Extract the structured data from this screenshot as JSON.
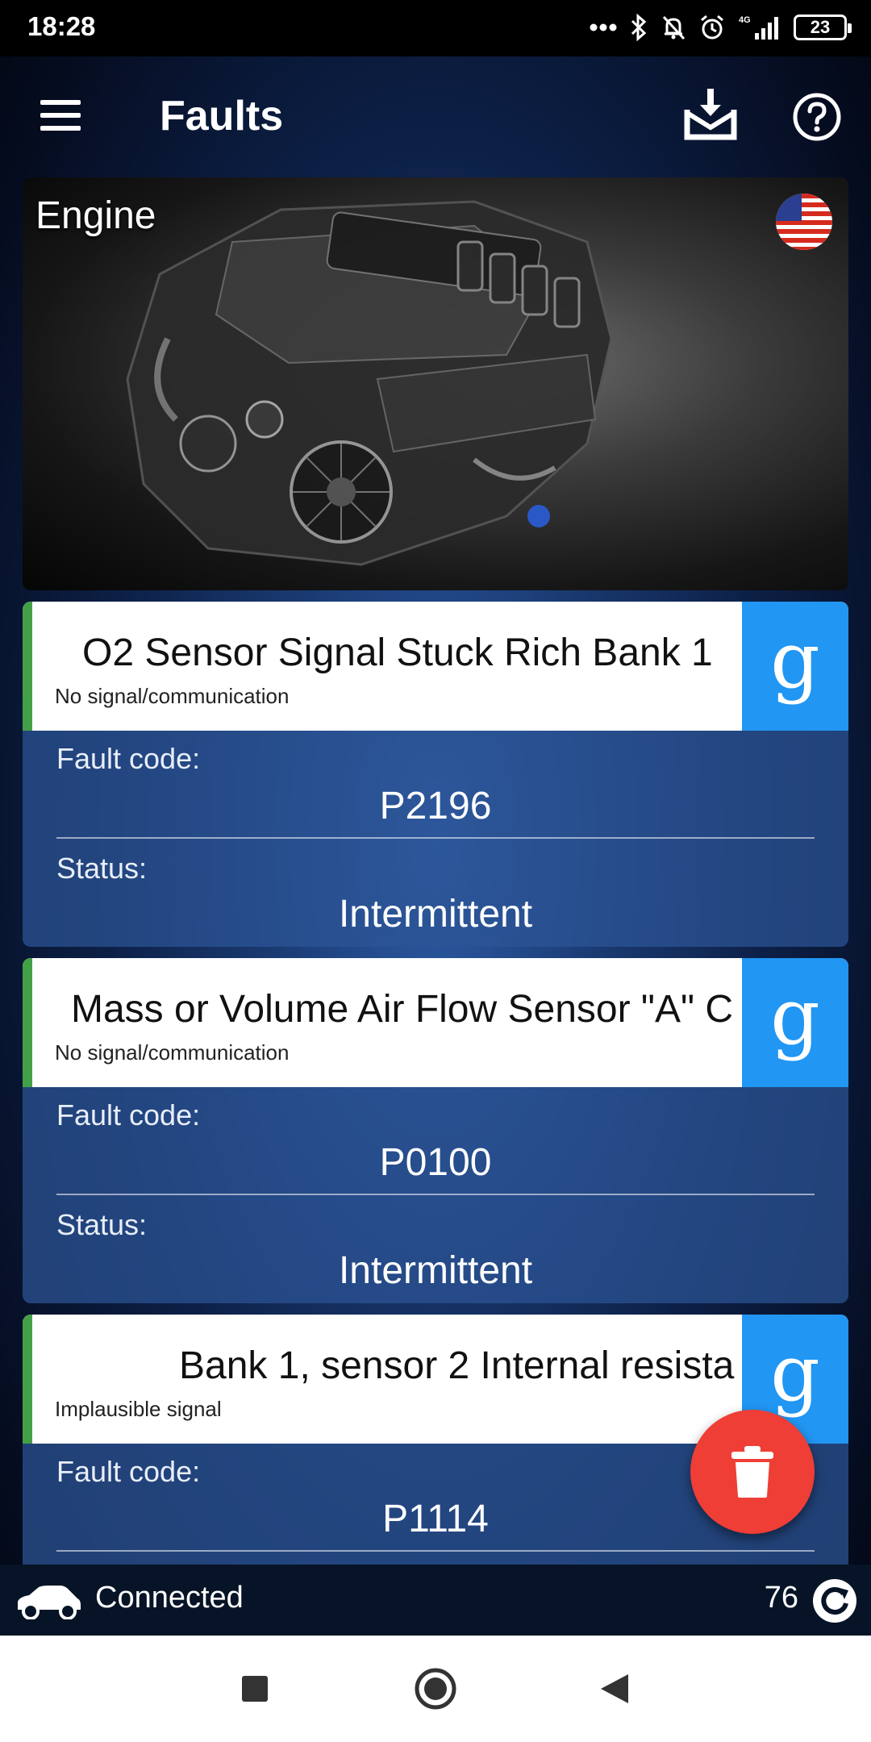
{
  "status_bar": {
    "time": "18:28",
    "network": "4G",
    "battery": "23"
  },
  "app_bar": {
    "title": "Faults"
  },
  "engine": {
    "label": "Engine"
  },
  "faults": [
    {
      "title": "O2 Sensor Signal Stuck Rich   Bank 1",
      "subtitle": "No signal/communication",
      "code_label": "Fault code:",
      "code": "P2196",
      "status_label": "Status:",
      "status": "Intermittent"
    },
    {
      "title": "Mass or Volume Air Flow Sensor \"A\" C",
      "subtitle": "No signal/communication",
      "code_label": "Fault code:",
      "code": "P0100",
      "status_label": "Status:",
      "status": "Intermittent"
    },
    {
      "title": "Bank 1, sensor 2 Internal resista",
      "subtitle": "Implausible signal",
      "code_label": "Fault code:",
      "code": "P1114"
    }
  ],
  "bottom_bar": {
    "connection": "Connected",
    "count": "76"
  },
  "icons": {
    "menu": "menu-icon",
    "save": "download-tray-icon",
    "help": "help-circle-icon",
    "flag": "us-flag-icon",
    "google": "google-g-icon",
    "delete": "trash-icon",
    "car": "car-icon",
    "refresh": "refresh-icon"
  },
  "colors": {
    "accent_blue": "#2196f3",
    "fab_red": "#ef3e36",
    "ok_green": "#43a047"
  }
}
